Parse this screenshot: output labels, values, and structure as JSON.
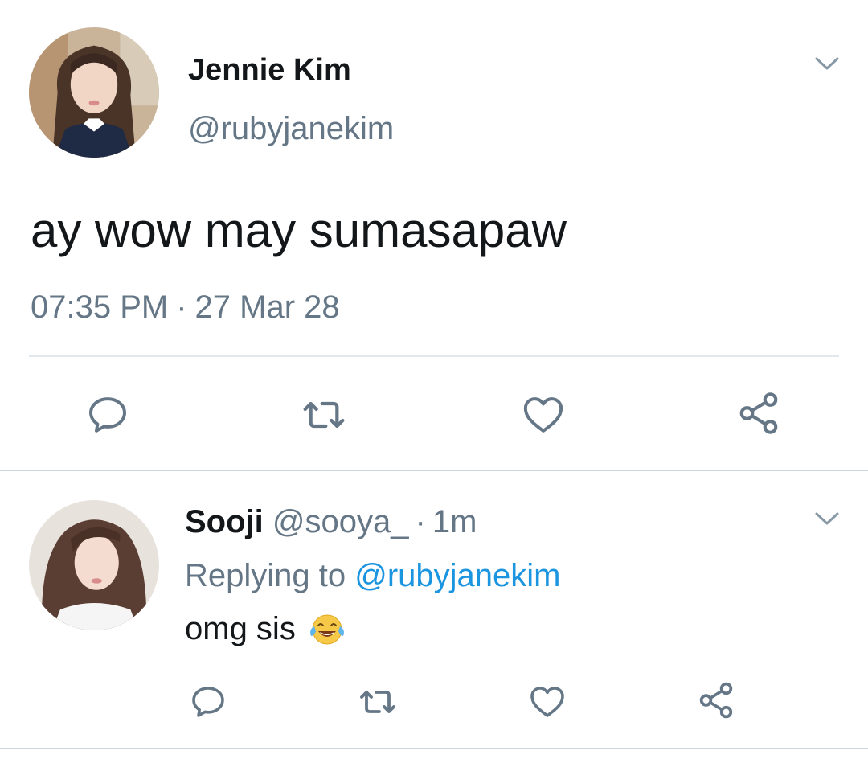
{
  "tweet": {
    "author_name": "Jennie Kim",
    "author_handle": "@rubyjanekim",
    "text": "ay wow may sumasapaw",
    "time": "07:35 PM",
    "separator": "·",
    "date": "27 Mar 28",
    "avatar_icon": "avatar-photo-icon",
    "menu_icon": "chevron-down-icon"
  },
  "actions": [
    {
      "name": "reply",
      "icon": "reply-icon"
    },
    {
      "name": "retweet",
      "icon": "retweet-icon"
    },
    {
      "name": "like",
      "icon": "heart-icon"
    },
    {
      "name": "share",
      "icon": "share-icon"
    }
  ],
  "reply": {
    "author_name": "Sooji",
    "author_handle": "@sooya_",
    "separator": "·",
    "time": "1m",
    "replying_prefix": "Replying to",
    "replying_handle": "@rubyjanekim",
    "text": "omg sis",
    "emoji_icon": "laughing-tears-emoji-icon"
  },
  "colors": {
    "text": "#14171a",
    "secondary": "#657786",
    "link": "#1b95e0",
    "icon": "#657786",
    "divider": "#e1e8ed"
  }
}
